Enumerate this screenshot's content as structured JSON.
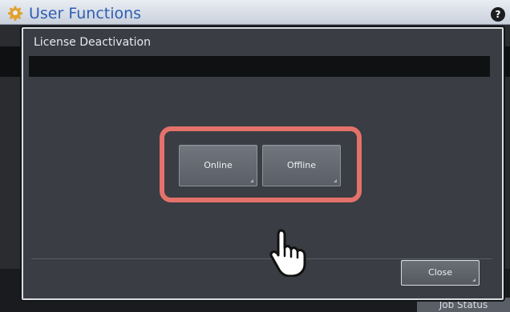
{
  "app": {
    "title": "User Functions",
    "help_label": "?",
    "job_status_label": "Job Status"
  },
  "dialog": {
    "title": "License Deactivation",
    "buttons": {
      "online": "Online",
      "offline": "Offline",
      "close": "Close"
    }
  },
  "colors": {
    "highlight": "#e4726b",
    "title_blue": "#2f5db3"
  },
  "icons": [
    "gear-icon",
    "help-icon",
    "pointing-hand-icon"
  ]
}
